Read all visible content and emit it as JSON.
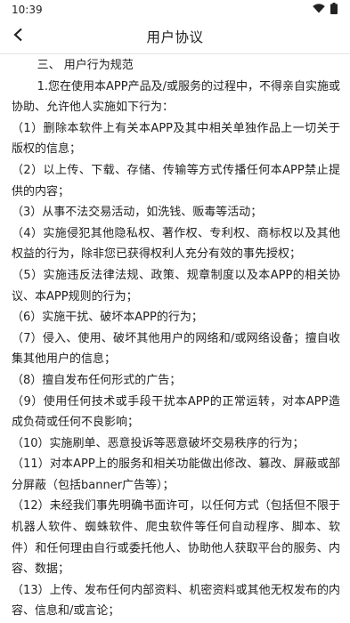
{
  "status_bar": {
    "time": "10:39"
  },
  "header": {
    "title": "用户协议"
  },
  "section": {
    "heading": "三、 用户行为规范",
    "intro": "1.您在使用本APP产品及/或服务的过程中，不得亲自实施或协助、允许他人实施如下行为：",
    "items": [
      "（1）删除本软件上有关本APP及其中相关单独作品上一切关于版权的信息；",
      "（2）以上传、下载、存储、传输等方式传播任何本APP禁止提供的内容；",
      "（3）从事不法交易活动，如洗钱、贩毒等活动；",
      "（4）实施侵犯其他隐私权、著作权、专利权、商标权以及其他权益的行为，除非您已获得权利人充分有效的事先授权；",
      "（5）实施违反法律法规、政策、规章制度以及本APP的相关协议、本APP规则的行为；",
      "（6）实施干扰、破坏本APP的行为；",
      "（7）侵入、使用、破坏其他用户的网络和/或网络设备；擅自收集其他用户的信息；",
      "（8）擅自发布任何形式的广告；",
      "（9）使用任何技术或手段干扰本APP的正常运转，对本APP造成负荷或任何不良影响；",
      "（10）实施刷单、恶意投诉等恶意破坏交易秩序的行为；",
      "（11）对本APP上的服务和相关功能做出修改、篡改、屏蔽或部分屏蔽（包括banner广告等）；",
      "（12）未经我们事先明确书面许可，以任何方式（包括但不限于机器人软件、蜘蛛软件、爬虫软件等任何自动程序、脚本、软件）和任何理由自行或委托他人、协助他人获取平台的服务、内容、数据；",
      "（13）上传、发布任何内部资料、机密资料或其他无权发布的内容、信息和/或言论；"
    ]
  },
  "icons": {
    "wifi": "wifi-icon",
    "battery": "battery-icon",
    "back": "back-arrow-icon"
  }
}
